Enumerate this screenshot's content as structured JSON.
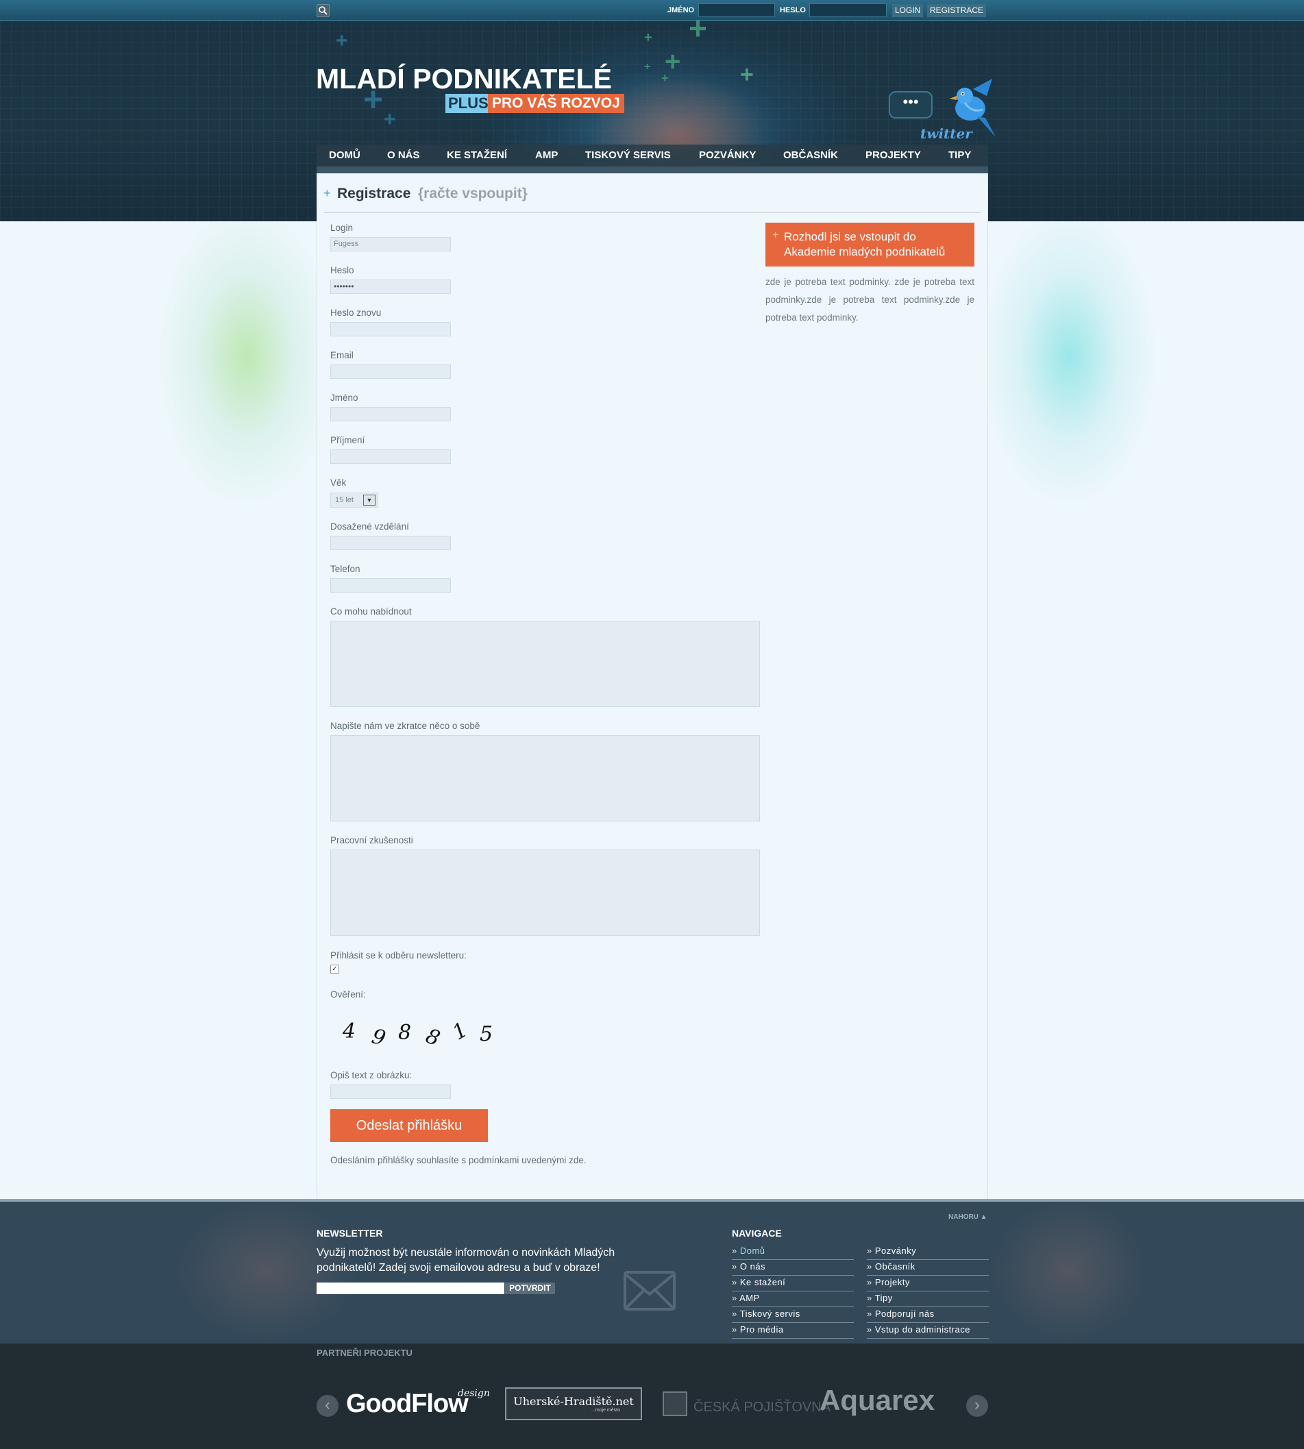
{
  "colors": {
    "accent": "#e6673e",
    "header": "#1c3646",
    "footer": "#33495a",
    "partners": "#222c33",
    "link": "#4a9ecf"
  },
  "topbar": {
    "search_icon": "search-icon",
    "name_label": "JMÉNO",
    "password_label": "HESLO",
    "login": "LOGIN",
    "register": "REGISTRACE"
  },
  "logo": {
    "title": "MLADÍ PODNIKATELÉ",
    "plus": "PLUS",
    "subtitle": "PRO VÁŠ ROZVOJ"
  },
  "twitter": {
    "bubble": "•••",
    "label": "twitter",
    "icon": "bird-icon"
  },
  "nav": [
    "DOMŮ",
    "O NÁS",
    "KE STAŽENÍ",
    "AMP",
    "TISKOVÝ SERVIS",
    "POZVÁNKY",
    "OBČASNÍK",
    "PROJEKTY",
    "TIPY"
  ],
  "page": {
    "plus": "+",
    "title": "Registrace",
    "subtitle": "{račte vspoupit}"
  },
  "form": {
    "login_label": "Login",
    "login_value": "Fugess",
    "password_label": "Heslo",
    "password_value": "•••••••",
    "password2_label": "Heslo znovu",
    "email_label": "Email",
    "firstname_label": "Jméno",
    "lastname_label": "Příjmení",
    "age_label": "Věk",
    "age_value": "15 let",
    "education_label": "Dosažené vzdělání",
    "phone_label": "Telefon",
    "offer_label": "Co mohu nabídnout",
    "about_label": "Napište nám ve zkratce něco o sobě",
    "experience_label": "Pracovní zkušenosti",
    "newsletter_label": "Přihlásit se k odběru newsletteru:",
    "newsletter_checked": "✓",
    "verify_label": "Ověření:",
    "captcha": [
      "4",
      "9",
      "8",
      "8",
      "1",
      "5"
    ],
    "captcha_input_label": "Opiš text z obrázku:",
    "submit": "Odeslat přihlášku",
    "agree": "Odesláním přihlášky souhlasíte s podmínkami uvedenými zde."
  },
  "sidebar": {
    "promo_plus": "+",
    "promo_line1": "Rozhodl jsi se vstoupit do",
    "promo_line2": "Akademie mladých podnikatelů",
    "text": "zde je potreba text podminky. zde je potreba text podminky.zde je potreba text podminky.zde je potreba text podminky."
  },
  "footer": {
    "nahoru": "NAHORU ▲",
    "newsletter_title": "NEWSLETTER",
    "newsletter_text": "Využij možnost být neustále informován o novinkách Mladých podnikatelů! Zadej svoji emailovou adresu a buď v obraze!",
    "newsletter_button": "POTVRDIT",
    "envelope_icon": "envelope-icon",
    "nav_title": "NAVIGACE",
    "nav_col1": [
      "Domů",
      "O nás",
      "Ke stažení",
      "AMP",
      "Tiskový servis",
      "Pro média"
    ],
    "nav_col2": [
      "Pozvánky",
      "Občasník",
      "Projekty",
      "Tipy",
      "Podporují nás",
      "Vstup do administrace"
    ],
    "bullet": "»"
  },
  "partners": {
    "title": "PARTNEŘI PROJEKTU",
    "prev": "‹",
    "next": "›",
    "logos": [
      "GoodFlow",
      "design",
      "Uherské-Hradiště.net",
      "...moje město",
      "ČESKÁ POJIŠŤOVNA",
      "Aquarex"
    ]
  }
}
